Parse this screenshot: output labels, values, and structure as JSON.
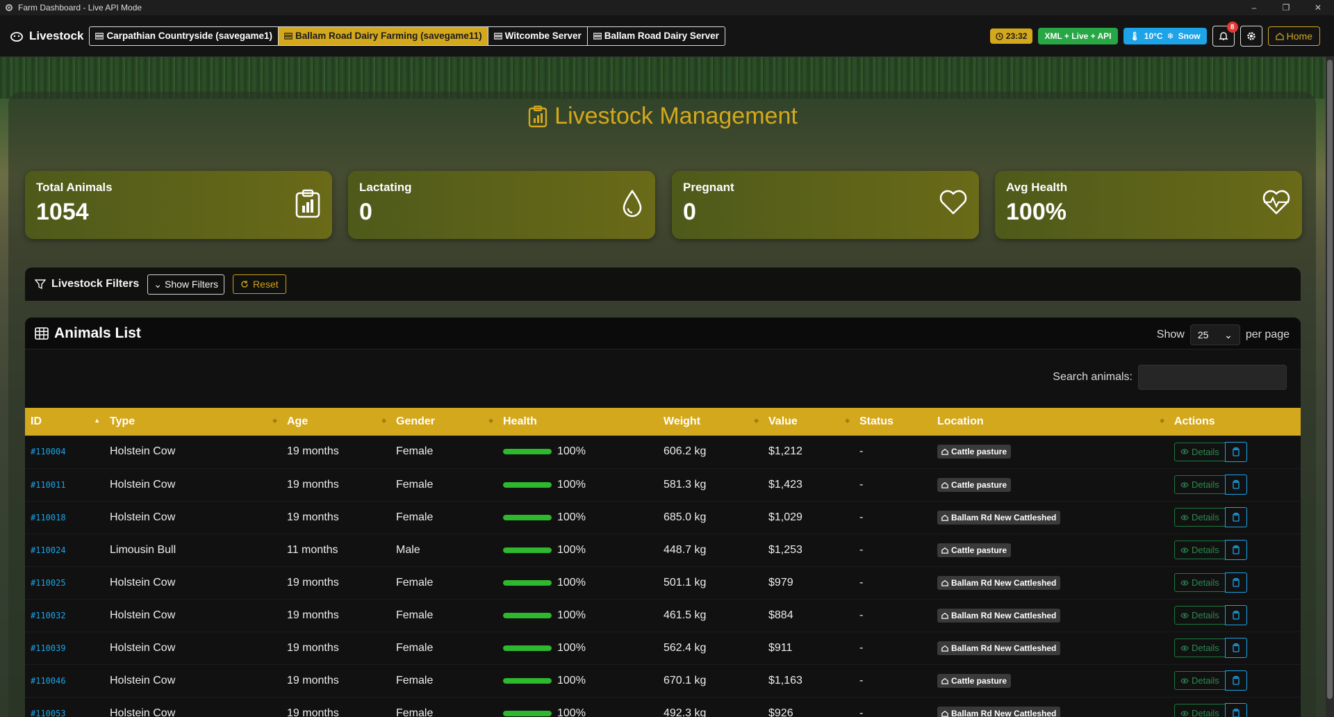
{
  "window": {
    "title": "Farm Dashboard - Live API Mode",
    "controls": [
      "–",
      "❐",
      "✕"
    ]
  },
  "navbar": {
    "brand": "Livestock",
    "servers": [
      {
        "label": "Carpathian Countryside (savegame1)",
        "active": false
      },
      {
        "label": "Ballam Road Dairy Farming (savegame11)",
        "active": true
      },
      {
        "label": "Witcombe Server",
        "active": false
      },
      {
        "label": "Ballam Road Dairy Server",
        "active": false
      }
    ],
    "time": "23:32",
    "mode": "XML + Live + API",
    "temperature": "10°C",
    "weather": "Snow",
    "notifications": "8",
    "home": "Home"
  },
  "page": {
    "title": "Livestock Management"
  },
  "stats": [
    {
      "label": "Total Animals",
      "value": "1054",
      "icon": "clipboard-chart-icon"
    },
    {
      "label": "Lactating",
      "value": "0",
      "icon": "droplet-icon"
    },
    {
      "label": "Pregnant",
      "value": "0",
      "icon": "heart-icon"
    },
    {
      "label": "Avg Health",
      "value": "100%",
      "icon": "heart-pulse-icon"
    }
  ],
  "filters": {
    "title": "Livestock Filters",
    "show_label": "Show Filters",
    "reset_label": "Reset"
  },
  "list": {
    "title": "Animals List",
    "show_label": "Show",
    "per_page_value": "25",
    "per_page_label": "per page",
    "search_label": "Search animals:",
    "search_value": "",
    "columns": [
      "ID",
      "Type",
      "Age",
      "Gender",
      "Health",
      "Weight",
      "Value",
      "Status",
      "Location",
      "Actions"
    ],
    "details_label": "Details",
    "rows": [
      {
        "id": "#110004",
        "type": "Holstein Cow",
        "age": "19 months",
        "gender": "Female",
        "health": "100%",
        "health_fraction": 1.0,
        "weight": "606.2 kg",
        "value": "$1,212",
        "status": "-",
        "location": "Cattle pasture"
      },
      {
        "id": "#110011",
        "type": "Holstein Cow",
        "age": "19 months",
        "gender": "Female",
        "health": "100%",
        "health_fraction": 1.0,
        "weight": "581.3 kg",
        "value": "$1,423",
        "status": "-",
        "location": "Cattle pasture"
      },
      {
        "id": "#110018",
        "type": "Holstein Cow",
        "age": "19 months",
        "gender": "Female",
        "health": "100%",
        "health_fraction": 1.0,
        "weight": "685.0 kg",
        "value": "$1,029",
        "status": "-",
        "location": "Ballam Rd New Cattleshed"
      },
      {
        "id": "#110024",
        "type": "Limousin Bull",
        "age": "11 months",
        "gender": "Male",
        "health": "100%",
        "health_fraction": 1.0,
        "weight": "448.7 kg",
        "value": "$1,253",
        "status": "-",
        "location": "Cattle pasture"
      },
      {
        "id": "#110025",
        "type": "Holstein Cow",
        "age": "19 months",
        "gender": "Female",
        "health": "100%",
        "health_fraction": 1.0,
        "weight": "501.1 kg",
        "value": "$979",
        "status": "-",
        "location": "Ballam Rd New Cattleshed"
      },
      {
        "id": "#110032",
        "type": "Holstein Cow",
        "age": "19 months",
        "gender": "Female",
        "health": "100%",
        "health_fraction": 1.0,
        "weight": "461.5 kg",
        "value": "$884",
        "status": "-",
        "location": "Ballam Rd New Cattleshed"
      },
      {
        "id": "#110039",
        "type": "Holstein Cow",
        "age": "19 months",
        "gender": "Female",
        "health": "100%",
        "health_fraction": 1.0,
        "weight": "562.4 kg",
        "value": "$911",
        "status": "-",
        "location": "Ballam Rd New Cattleshed"
      },
      {
        "id": "#110046",
        "type": "Holstein Cow",
        "age": "19 months",
        "gender": "Female",
        "health": "100%",
        "health_fraction": 1.0,
        "weight": "670.1 kg",
        "value": "$1,163",
        "status": "-",
        "location": "Cattle pasture"
      },
      {
        "id": "#110053",
        "type": "Holstein Cow",
        "age": "19 months",
        "gender": "Female",
        "health": "100%",
        "health_fraction": 1.0,
        "weight": "492.3 kg",
        "value": "$926",
        "status": "-",
        "location": "Ballam Rd New Cattleshed"
      }
    ]
  },
  "colors": {
    "accent": "#d4a81c",
    "link": "#1ca3e8",
    "success": "#2eb82e"
  }
}
